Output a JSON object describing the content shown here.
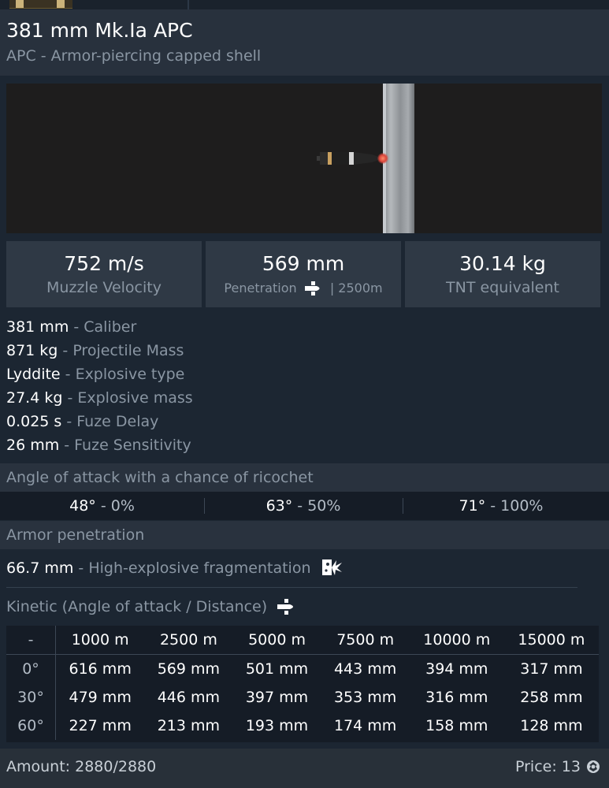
{
  "shell": {
    "title": "381 mm Mk.Ia APC",
    "subtitle": "APC - Armor-piercing capped shell"
  },
  "stats": [
    {
      "value": "752 m/s",
      "label": "Muzzle Velocity"
    },
    {
      "value": "569 mm",
      "label": "Penetration",
      "label_suffix": "| 2500m",
      "icon": "kinetic-shell-icon"
    },
    {
      "value": "30.14 kg",
      "label": "TNT equivalent"
    }
  ],
  "properties": [
    {
      "value": "381 mm",
      "sep": " - ",
      "label": "Caliber"
    },
    {
      "value": "871 kg",
      "sep": " - ",
      "label": "Projectile Mass"
    },
    {
      "value": "Lyddite",
      "sep": " - ",
      "label": "Explosive type"
    },
    {
      "value": "27.4 kg",
      "sep": " - ",
      "label": "Explosive mass"
    },
    {
      "value": "0.025 s",
      "sep": " - ",
      "label": "Fuze Delay"
    },
    {
      "value": "26 mm",
      "sep": " - ",
      "label": "Fuze Sensitivity"
    }
  ],
  "ricochet": {
    "title": "Angle of attack with a chance of ricochet",
    "items": [
      {
        "angle": "48°",
        "sep": " - ",
        "chance": "0%"
      },
      {
        "angle": "63°",
        "sep": " - ",
        "chance": "50%"
      },
      {
        "angle": "71°",
        "sep": " - ",
        "chance": "100%"
      }
    ]
  },
  "armor": {
    "title": "Armor penetration",
    "he_value": "66.7 mm",
    "he_sep": " - ",
    "he_label": "High-explosive fragmentation",
    "kinetic_label": "Kinetic (Angle of attack / Distance)",
    "icons": {
      "he": "explosion-icon",
      "kinetic": "kinetic-shell-icon"
    }
  },
  "penetration_table": {
    "corner": "-",
    "distances": [
      "1000 m",
      "2500 m",
      "5000 m",
      "7500 m",
      "10000 m",
      "15000 m"
    ],
    "rows": [
      {
        "angle": "0°",
        "values": [
          "616 mm",
          "569 mm",
          "501 mm",
          "443 mm",
          "394 mm",
          "317 mm"
        ]
      },
      {
        "angle": "30°",
        "values": [
          "479 mm",
          "446 mm",
          "397 mm",
          "353 mm",
          "316 mm",
          "258 mm"
        ]
      },
      {
        "angle": "60°",
        "values": [
          "227 mm",
          "213 mm",
          "193 mm",
          "174 mm",
          "158 mm",
          "128 mm"
        ]
      }
    ]
  },
  "footer": {
    "amount": "Amount: 2880/2880",
    "price": "Price: 13",
    "currency_icon": "silver-lion-icon"
  },
  "colors": {
    "background": "#1c2632",
    "panel": "#28313d",
    "stat_box": "#2f3945",
    "table_bg": "#151c26",
    "muted_text": "#8a96a3"
  }
}
